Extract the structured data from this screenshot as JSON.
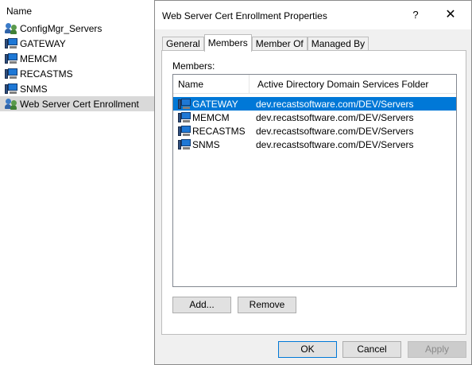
{
  "background_list": {
    "header": "Name",
    "items": [
      {
        "label": "ConfigMgr_Servers",
        "icon": "group-icon",
        "selected": false
      },
      {
        "label": "GATEWAY",
        "icon": "computer-icon",
        "selected": false
      },
      {
        "label": "MEMCM",
        "icon": "computer-icon",
        "selected": false
      },
      {
        "label": "RECASTMS",
        "icon": "computer-icon",
        "selected": false
      },
      {
        "label": "SNMS",
        "icon": "computer-icon",
        "selected": false
      },
      {
        "label": "Web Server Cert Enrollment",
        "icon": "group-icon",
        "selected": true
      }
    ]
  },
  "dialog": {
    "title": "Web Server Cert Enrollment Properties",
    "help_label": "?",
    "close_label": "✕",
    "tabs": [
      {
        "label": "General",
        "active": false
      },
      {
        "label": "Members",
        "active": true
      },
      {
        "label": "Member Of",
        "active": false
      },
      {
        "label": "Managed By",
        "active": false
      }
    ],
    "members_label": "Members:",
    "columns": [
      "Name",
      "Active Directory Domain Services Folder"
    ],
    "rows": [
      {
        "name": "GATEWAY",
        "folder": "dev.recastsoftware.com/DEV/Servers",
        "selected": true
      },
      {
        "name": "MEMCM",
        "folder": "dev.recastsoftware.com/DEV/Servers",
        "selected": false
      },
      {
        "name": "RECASTMS",
        "folder": "dev.recastsoftware.com/DEV/Servers",
        "selected": false
      },
      {
        "name": "SNMS",
        "folder": "dev.recastsoftware.com/DEV/Servers",
        "selected": false
      }
    ],
    "add_label": "Add...",
    "remove_label": "Remove",
    "ok_label": "OK",
    "cancel_label": "Cancel",
    "apply_label": "Apply"
  },
  "colors": {
    "selection": "#0078d7",
    "dialog_bg": "#f0f0f0"
  }
}
